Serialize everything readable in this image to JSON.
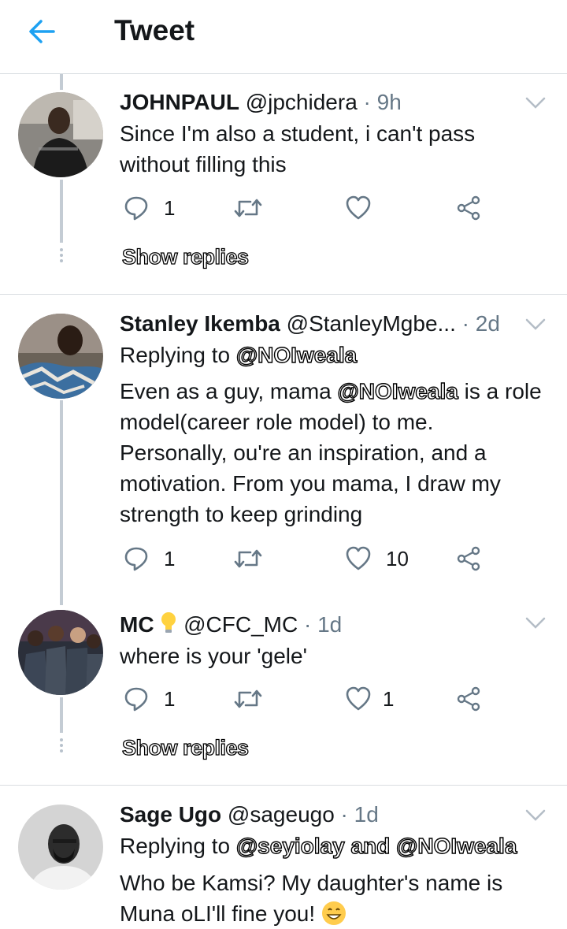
{
  "header": {
    "title": "Tweet"
  },
  "tweets": [
    {
      "name": "JOHNPAUL",
      "handle": "@jpchidera",
      "sep": " · ",
      "time": "9h",
      "text": "Since I'm also a student, i can't pass without filling this",
      "replies": "1",
      "retweets": "",
      "likes": "",
      "show_replies": "Show replies"
    },
    {
      "name": "Stanley Ikemba",
      "handle": "@StanleyMgbe...",
      "sep": " · ",
      "time": "2d",
      "replying_prefix": "Replying to",
      "replying_mentions": [
        "@NOIweala"
      ],
      "text_before": "Even as a guy, mama ",
      "text_mention": "@NOIweala",
      "text_after": " is a role model(career role model) to me. Personally, ou're an inspiration, and a motivation. From you mama, I draw my strength to keep grinding",
      "replies": "1",
      "retweets": "",
      "likes": "10"
    },
    {
      "name": "MC",
      "badge_icon": "lightbulb-icon",
      "handle": "@CFC_MC",
      "sep": " · ",
      "time": "1d",
      "text": "where is your 'gele'",
      "replies": "1",
      "retweets": "",
      "likes": "1",
      "show_replies": "Show replies"
    },
    {
      "name": "Sage Ugo",
      "handle": "@sageugo",
      "sep": " · ",
      "time": "1d",
      "replying_prefix": "Replying to",
      "replying_mention_1": "@seyiolay",
      "replying_and": "and",
      "replying_mention_2": "@NOIweala",
      "text": "Who be Kamsi? My daughter's name is Muna oLI'll fine you!"
    }
  ],
  "colors": {
    "accent": "#1da1f2",
    "muted": "#657786",
    "thread": "#c4ccd4",
    "divider": "#d9dde1"
  }
}
